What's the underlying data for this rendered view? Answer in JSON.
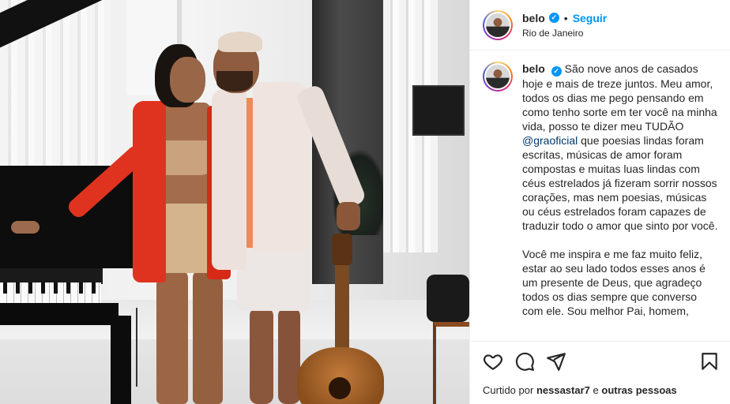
{
  "post": {
    "username": "belo",
    "follow_label": "Seguir",
    "separator": "•",
    "location": "Rio de Janeiro",
    "verified_mark": "✓",
    "photo_alt": "Foto do casal"
  },
  "caption": {
    "username": "belo",
    "text_part1": "São nove anos de casados hoje e mais de treze juntos. Meu amor, todos os dias me pego pensando em como tenho sorte em ter você na minha vida, posso te dizer meu TUDÃO ",
    "mention": "@graoficial",
    "text_part2": " que poesias lindas foram escritas, músicas de amor foram compostas e muitas luas lindas com céus estrelados já fizeram sorrir nossos corações, mas nem poesias, músicas ou céus estrelados foram capazes de traduzir todo o amor que sinto por você.",
    "paragraph2": "Você me inspira e me faz muito feliz, estar ao seu lado todos esses anos é um presente de Deus, que agradeço todos os dias sempre que converso com ele. Sou melhor Pai, homem,"
  },
  "actions": {
    "icons": [
      "heart-icon",
      "comment-icon",
      "share-icon",
      "bookmark-icon"
    ],
    "liked_prefix": "Curtido por",
    "liked_user": "nessastar7",
    "liked_and": "e",
    "liked_others": "outras pessoas"
  },
  "colors": {
    "accent": "#0095f6",
    "mention": "#00376b",
    "text": "#262626",
    "border": "#efefef"
  }
}
